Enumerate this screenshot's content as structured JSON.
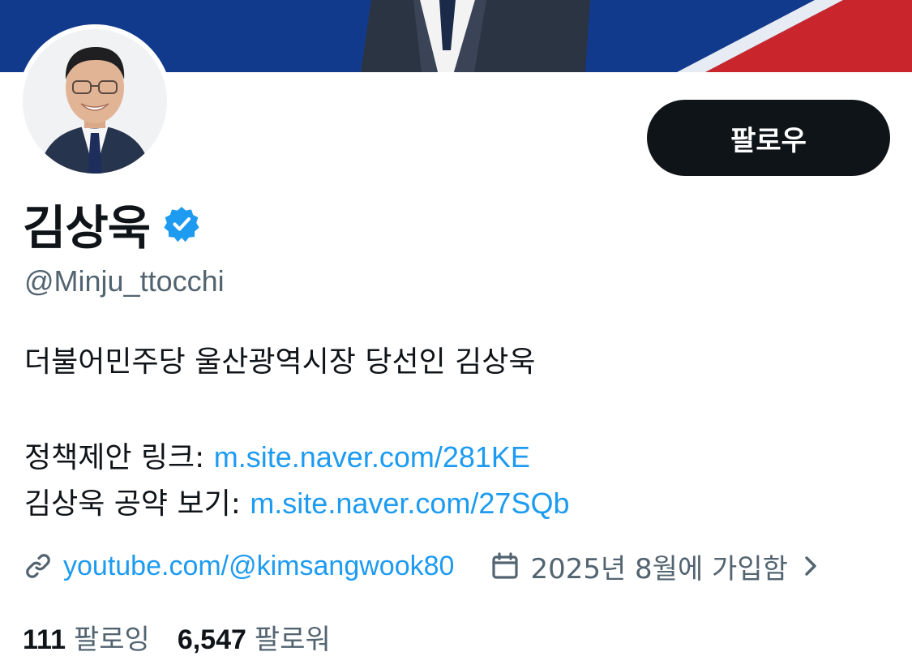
{
  "profile": {
    "display_name": "김상욱",
    "handle": "@Minju_ttocchi",
    "verified_icon": "verified-badge-icon",
    "follow_label": "팔로우"
  },
  "bio": {
    "line1": "더불어민주당 울산광역시장 당선인 김상욱",
    "policy_label": "정책제안 링크: ",
    "policy_link": "m.site.naver.com/281KE",
    "pledge_label": "김상욱 공약 보기: ",
    "pledge_link": "m.site.naver.com/27SQb"
  },
  "meta": {
    "website": "youtube.com/@kimsangwook80",
    "joined": "2025년 8월에 가입함",
    "icons": [
      "link-icon",
      "calendar-icon",
      "chevron-right-icon"
    ]
  },
  "stats": {
    "following_count": "111",
    "following_label": "팔로잉",
    "followers_count": "6,547",
    "followers_label": "팔로워"
  },
  "colors": {
    "banner_blue": "#123a8c",
    "banner_red": "#c8262c",
    "link": "#1d9bf0",
    "secondary_text": "#536471",
    "button_bg": "#0f1419"
  }
}
